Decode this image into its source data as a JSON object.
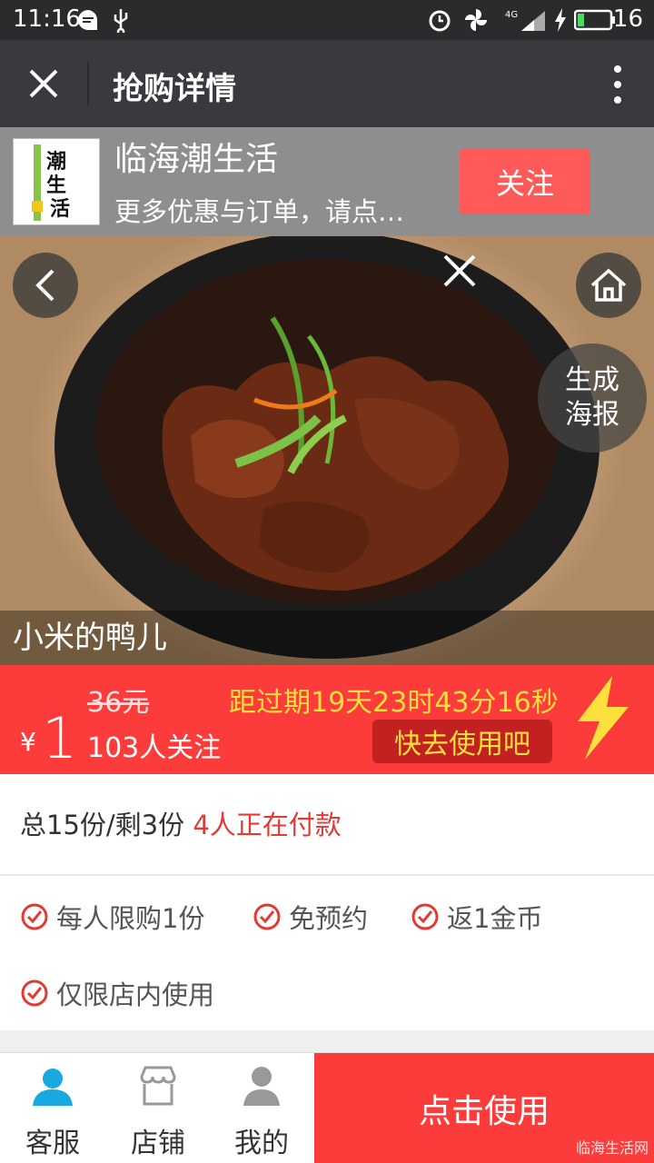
{
  "status_bar": {
    "time": "11:16",
    "battery": "16"
  },
  "title_bar": {
    "title": "抢购详情"
  },
  "shop": {
    "name": "临海潮生活",
    "subtitle": "更多优惠与订单，请点…",
    "follow_label": "关注",
    "logo_text": "潮生活"
  },
  "hero": {
    "caption": "小米的鸭儿",
    "poster_line1": "生成",
    "poster_line2": "海报"
  },
  "price": {
    "currency": "¥",
    "value": "1",
    "original": "36元",
    "followers": "103人关注",
    "countdown": "距过期19天23时43分16秒",
    "use_label": "快去使用吧"
  },
  "stock": {
    "text": "总15份/剩3份",
    "paying": "4人正在付款"
  },
  "features": [
    "每人限购1份",
    "免预约",
    "返1金币",
    "仅限店内使用"
  ],
  "bottom_nav": {
    "tabs": [
      {
        "label": "客服",
        "icon": "customer-service-icon"
      },
      {
        "label": "店铺",
        "icon": "store-icon"
      },
      {
        "label": "我的",
        "icon": "profile-icon"
      }
    ],
    "action_label": "点击使用",
    "watermark": "临海生活网"
  },
  "colors": {
    "accent_red": "#fc3b3b",
    "countdown_yellow": "#ffe03c",
    "follow_button": "#ff5a5a",
    "tab_active": "#1aa8e0"
  }
}
